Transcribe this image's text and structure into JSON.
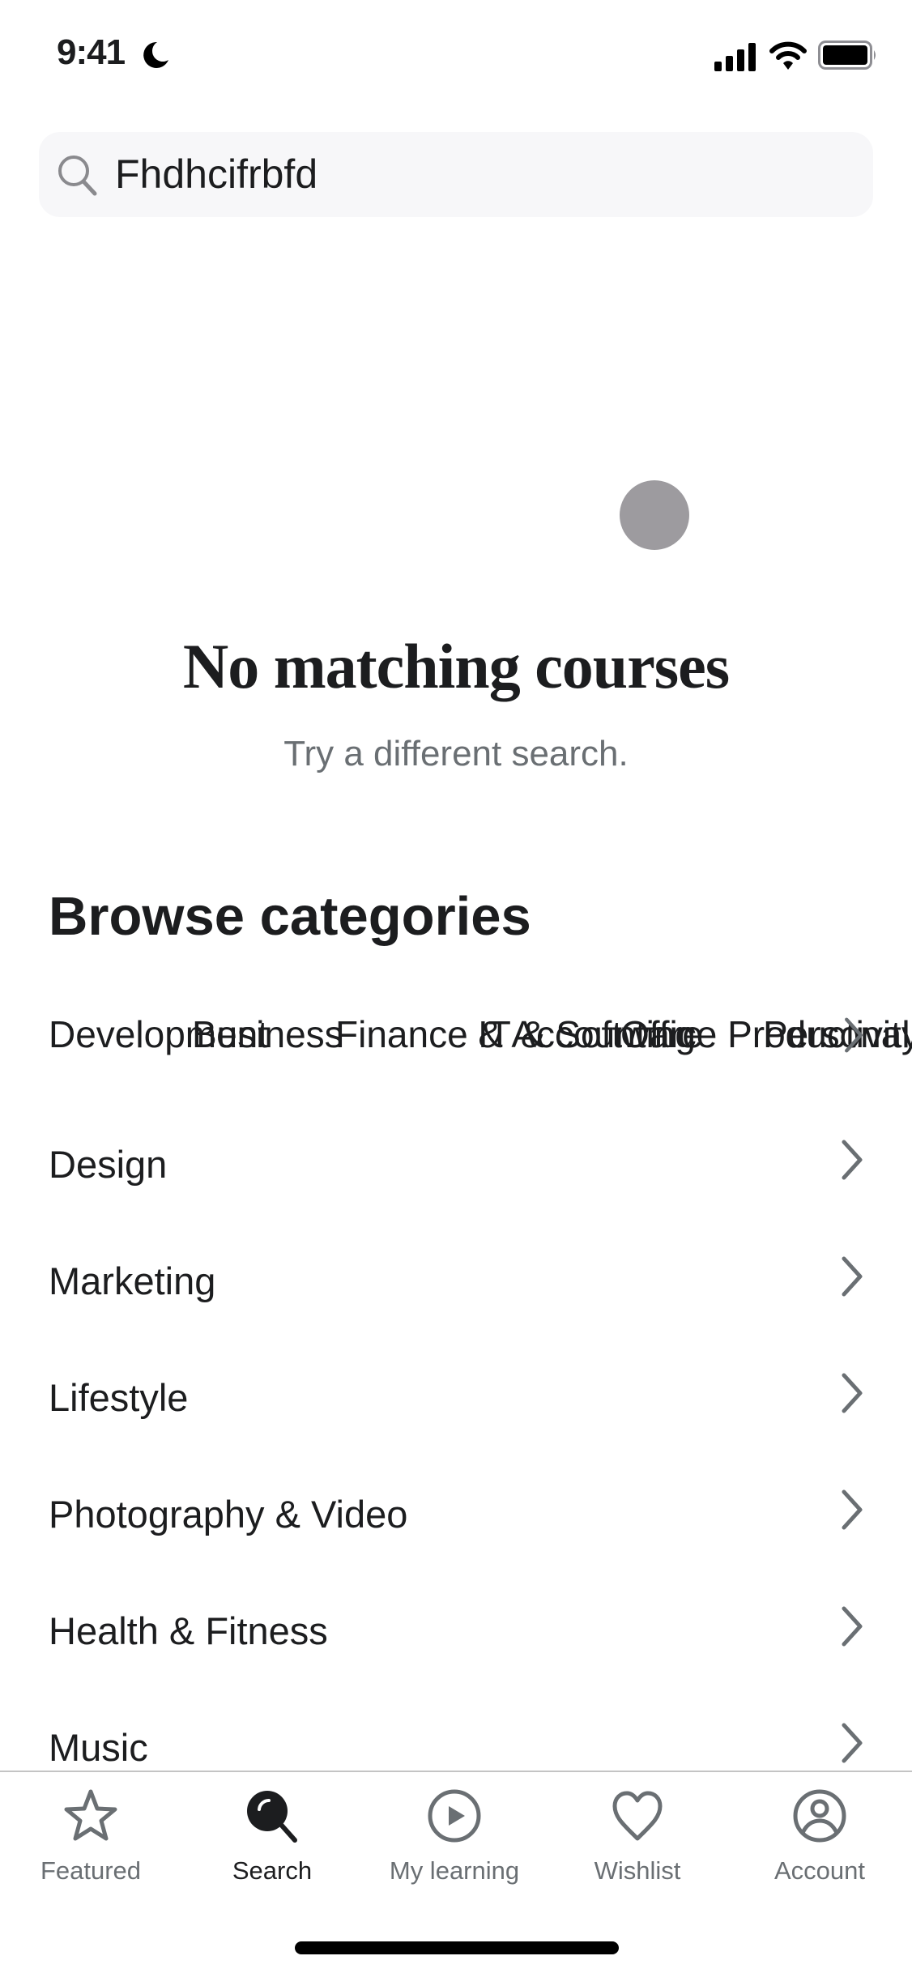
{
  "status_bar": {
    "time": "9:41",
    "moon_icon": "moon-icon",
    "signal_icon": "signal-icon",
    "wifi_icon": "wifi-icon",
    "battery_icon": "battery-icon"
  },
  "search": {
    "value": "Fhdhcifrbfd",
    "icon": "search-icon"
  },
  "empty_state": {
    "title": "No matching courses",
    "subtitle": "Try a different search.",
    "loading_dot_color": "#9d9b9f"
  },
  "browse": {
    "title": "Browse categories",
    "overlapping_categories": [
      "Development",
      "Business",
      "Finance & Accounting",
      "IT & Software",
      "Office Productivity",
      "Personal Development"
    ],
    "categories": [
      {
        "label": "Design"
      },
      {
        "label": "Marketing"
      },
      {
        "label": "Lifestyle"
      },
      {
        "label": "Photography & Video"
      },
      {
        "label": "Health & Fitness"
      },
      {
        "label": "Music"
      }
    ]
  },
  "tab_bar": {
    "active": "Search",
    "tabs": [
      {
        "label": "Featured",
        "icon": "star-icon"
      },
      {
        "label": "Search",
        "icon": "search-icon"
      },
      {
        "label": "My learning",
        "icon": "play-circle-icon"
      },
      {
        "label": "Wishlist",
        "icon": "heart-icon"
      },
      {
        "label": "Account",
        "icon": "account-icon"
      }
    ]
  },
  "colors": {
    "text": "#1c1d1f",
    "muted": "#6a6f73",
    "search_bg": "#f7f7f9",
    "chevron": "#6a6f73"
  }
}
